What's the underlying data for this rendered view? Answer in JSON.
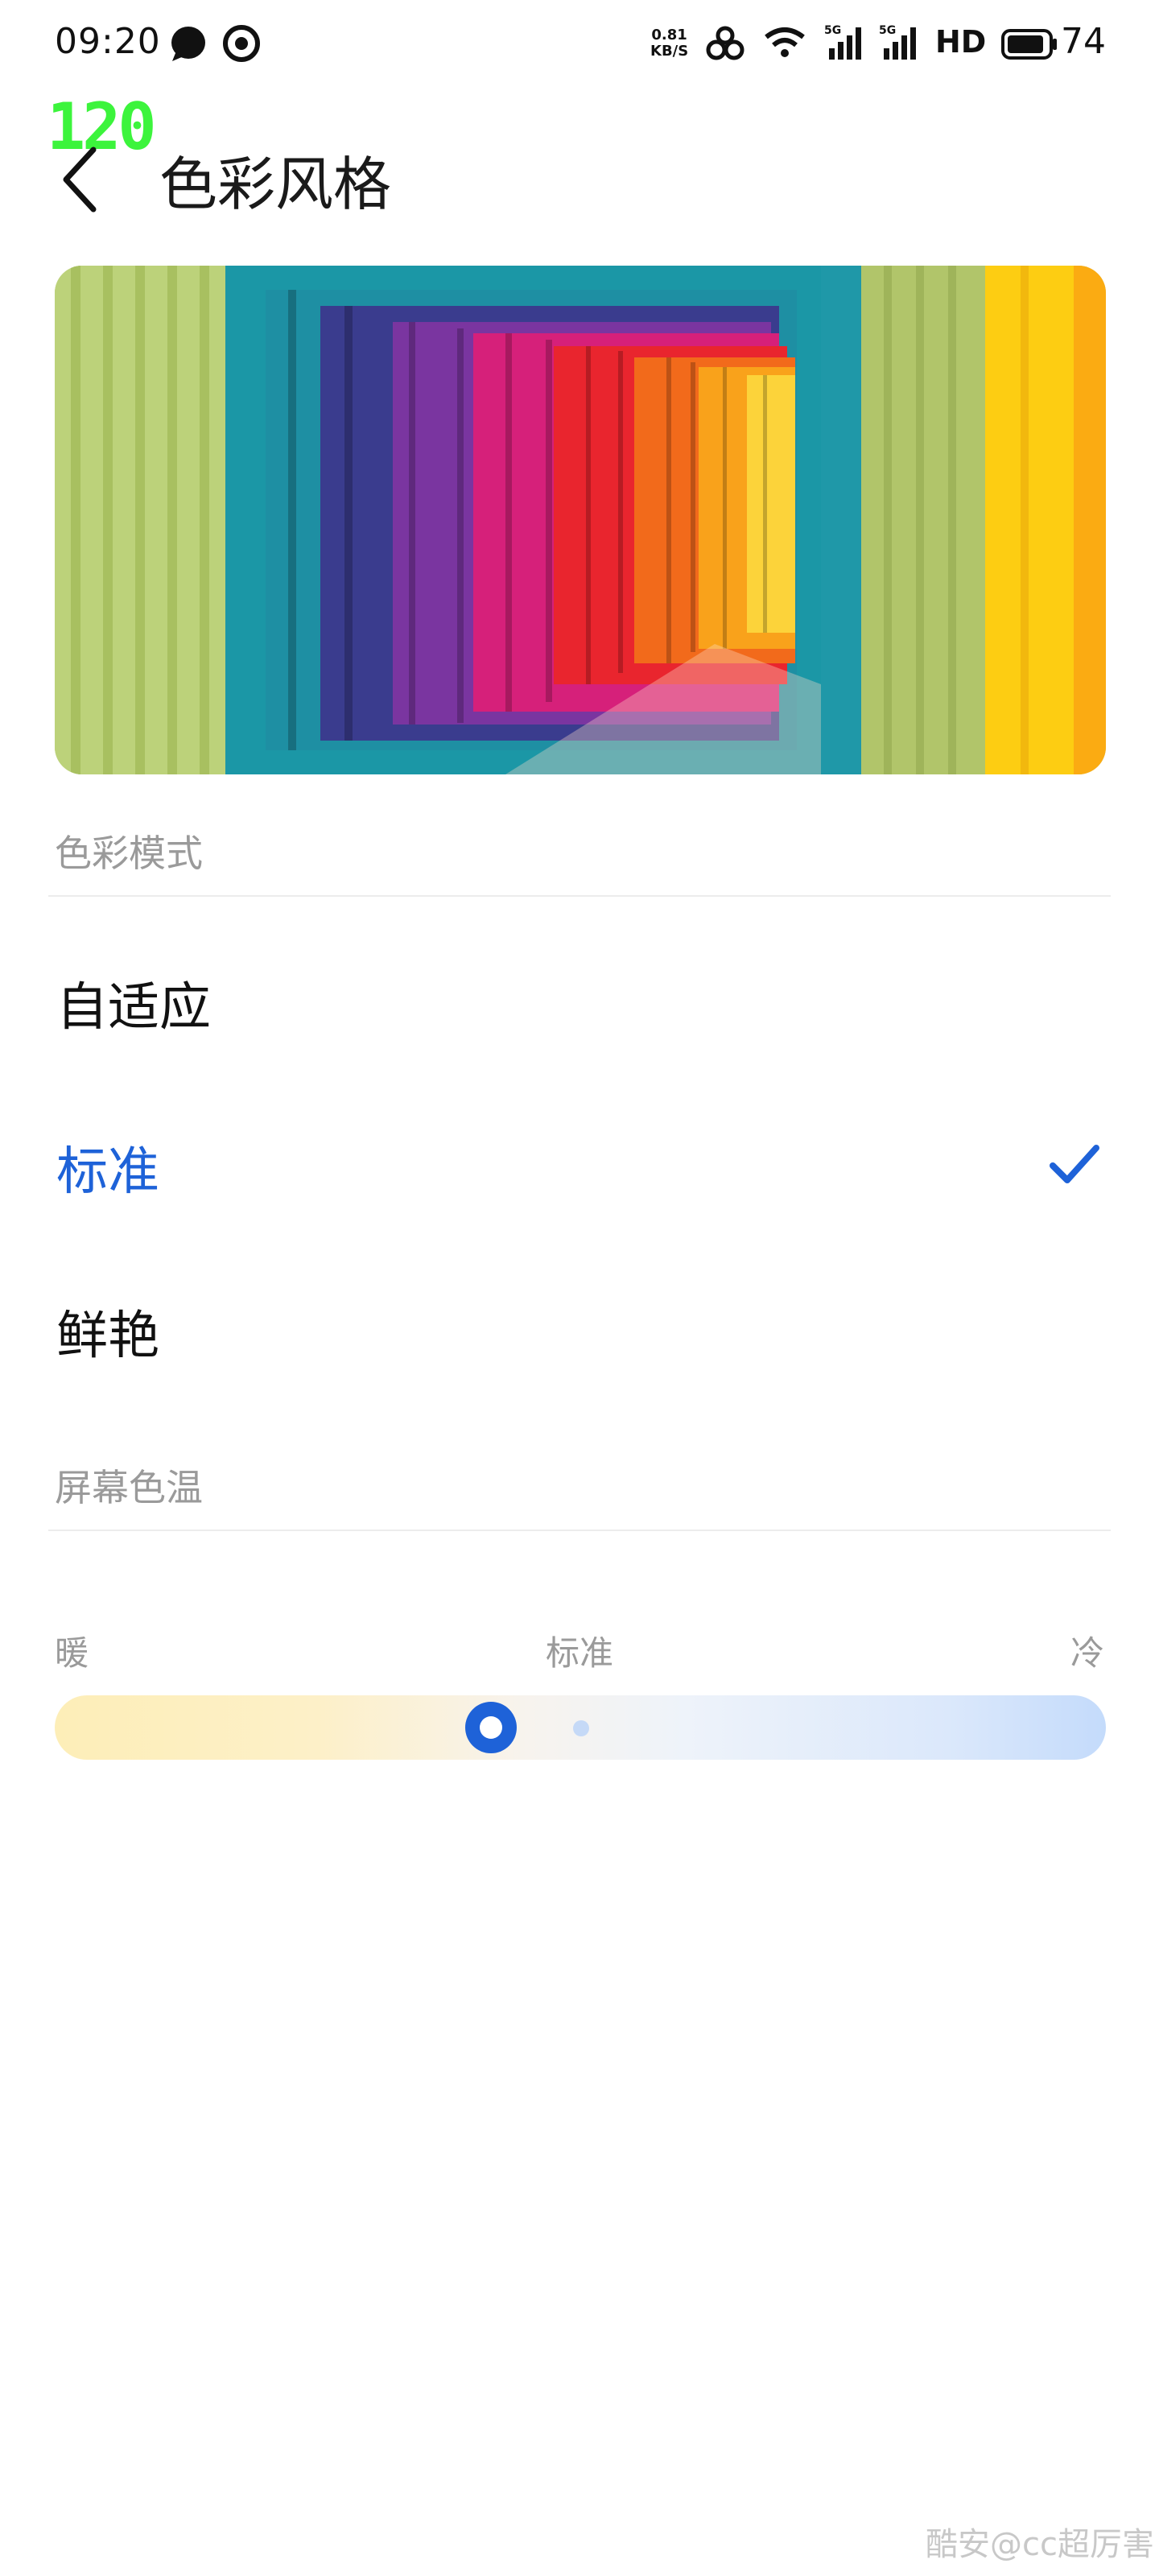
{
  "status_bar": {
    "time": "09:20",
    "net_speed_value": "0.81",
    "net_speed_unit": "KB/S",
    "network_type_1": "5G",
    "network_type_2": "5G",
    "hd_label": "HD",
    "battery": "74"
  },
  "fps_overlay": "120",
  "header": {
    "title": "色彩风格"
  },
  "color_mode": {
    "section_label": "色彩模式",
    "options": [
      {
        "label": "自适应",
        "selected": false
      },
      {
        "label": "标准",
        "selected": true
      },
      {
        "label": "鲜艳",
        "selected": false
      }
    ]
  },
  "color_temperature": {
    "section_label": "屏幕色温",
    "warm_label": "暖",
    "standard_label": "标准",
    "cool_label": "冷",
    "slider_value": 0.415
  },
  "watermark": "酷安@cc超厉害",
  "colors": {
    "accent": "#1e62d8",
    "fps": "#3cf43c"
  }
}
